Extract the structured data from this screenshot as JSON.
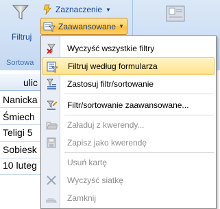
{
  "ribbon": {
    "filter_button": {
      "label": "Filtruj",
      "icon": "funnel-icon"
    },
    "selection_button": {
      "label": "Zaznaczenie",
      "icon": "selection-lightning-icon"
    },
    "advanced_button": {
      "label": "Zaawansowane",
      "icon": "advanced-filter-icon"
    },
    "group_label": "Sortowa",
    "right_icon": "save-record-icon"
  },
  "table": {
    "column_header": "ulic",
    "rows": [
      "Nanicka",
      "Śmiech",
      "Teligi 5",
      "Sobiesk",
      "10 luteg"
    ]
  },
  "menu": {
    "items": [
      {
        "label": "Wyczyść wszystkie filtry",
        "icon": "clear-filters-icon",
        "enabled": true,
        "highlighted": false
      },
      {
        "label": "Filtruj według formularza",
        "icon": "filter-by-form-icon",
        "enabled": true,
        "highlighted": true
      },
      {
        "label": "Zastosuj filtr/sortowanie",
        "icon": "apply-filter-sort-icon",
        "enabled": true,
        "highlighted": false
      },
      {
        "label": "Filtr/sortowanie zaawansowane...",
        "icon": "advanced-filter-sort-icon",
        "enabled": true,
        "highlighted": false
      },
      {
        "label": "Załaduj z kwerendy...",
        "icon": "load-from-query-icon",
        "enabled": false,
        "highlighted": false
      },
      {
        "label": "Zapisz jako kwerendę",
        "icon": "save-as-query-icon",
        "enabled": false,
        "highlighted": false
      },
      {
        "label": "Usuń kartę",
        "icon": "delete-tab-icon",
        "enabled": false,
        "highlighted": false
      },
      {
        "label": "Wyczyść siatkę",
        "icon": "clear-grid-icon",
        "enabled": false,
        "highlighted": false
      },
      {
        "label": "Zamknij",
        "icon": "close-icon",
        "enabled": false,
        "highlighted": false
      }
    ]
  },
  "colors": {
    "ribbon_bg": "#cfe0f5",
    "highlight": "#ffe28e",
    "accent_text": "#15428b"
  }
}
